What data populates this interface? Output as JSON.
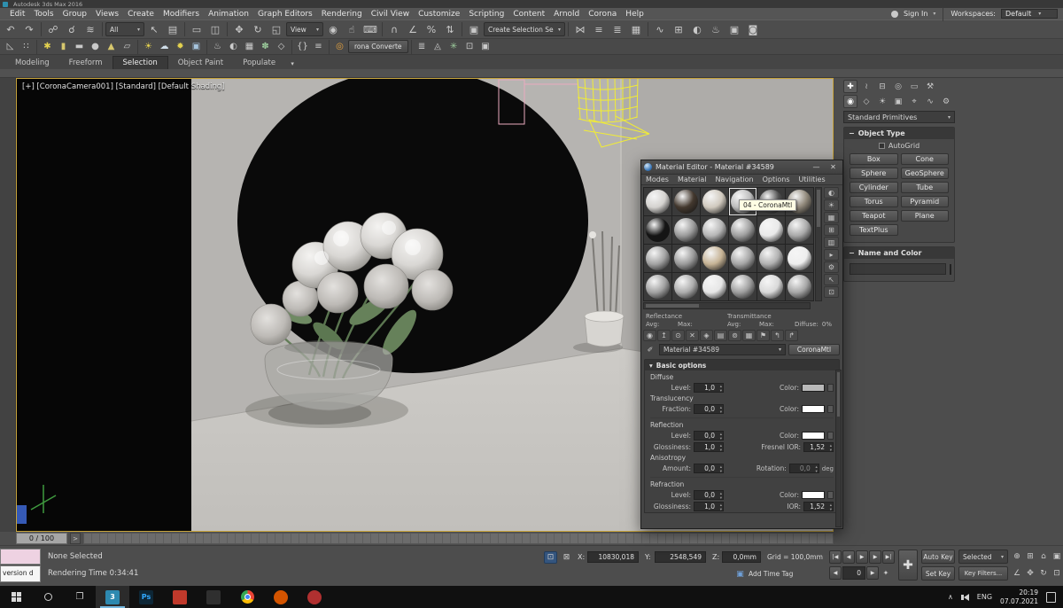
{
  "titlebar": {
    "app_title": "Autodesk 3ds Max 2016"
  },
  "menubar": {
    "items": [
      "Edit",
      "Tools",
      "Group",
      "Views",
      "Create",
      "Modifiers",
      "Animation",
      "Graph Editors",
      "Rendering",
      "Civil View",
      "Customize",
      "Scripting",
      "Content",
      "Arnold",
      "Corona",
      "Help"
    ],
    "sign_in": "Sign In",
    "workspaces_label": "Workspaces:",
    "workspace_value": "Default"
  },
  "toolbar_main": {
    "icons": [
      {
        "type": "icon",
        "name": "undo-icon",
        "glyph": "↶"
      },
      {
        "type": "icon",
        "name": "redo-icon",
        "glyph": "↷"
      },
      {
        "type": "sep"
      },
      {
        "type": "icon",
        "name": "select-and-link-icon",
        "glyph": "☍"
      },
      {
        "type": "icon",
        "name": "unlink-selection-icon",
        "glyph": "☌"
      },
      {
        "type": "icon",
        "name": "bind-to-space-warp-icon",
        "glyph": "≋"
      },
      {
        "type": "sep"
      },
      {
        "type": "dropdown",
        "name": "selection-filter-dropdown",
        "value": "All",
        "w": 44
      },
      {
        "type": "icon",
        "name": "select-object-icon",
        "glyph": "↖"
      },
      {
        "type": "icon",
        "name": "select-by-name-icon",
        "glyph": "▤"
      },
      {
        "type": "sep"
      },
      {
        "type": "icon",
        "name": "rectangular-selection-region-icon",
        "glyph": "▭"
      },
      {
        "type": "icon",
        "name": "window-crossing-toggle-icon",
        "glyph": "◫"
      },
      {
        "type": "sep"
      },
      {
        "type": "icon",
        "name": "select-and-move-icon",
        "glyph": "✥"
      },
      {
        "type": "icon",
        "name": "select-and-rotate-icon",
        "glyph": "↻"
      },
      {
        "type": "icon",
        "name": "select-and-scale-icon",
        "glyph": "◱"
      },
      {
        "type": "dropdown",
        "name": "reference-coordinate-dropdown",
        "value": "View",
        "w": 42
      },
      {
        "type": "icon",
        "name": "use-pivot-point-icon",
        "glyph": "◉"
      },
      {
        "type": "icon",
        "name": "select-and-manipulate-icon",
        "glyph": "☝"
      },
      {
        "type": "icon",
        "name": "keyboard-shortcut-override-icon",
        "glyph": "⌨"
      },
      {
        "type": "sep"
      },
      {
        "type": "icon",
        "name": "snap-toggle-3d-icon",
        "glyph": "∩"
      },
      {
        "type": "icon",
        "name": "angle-snap-icon",
        "glyph": "∠"
      },
      {
        "type": "icon",
        "name": "percent-snap-icon",
        "glyph": "%"
      },
      {
        "type": "icon",
        "name": "spinner-snap-icon",
        "glyph": "⇅"
      },
      {
        "type": "sep"
      },
      {
        "type": "icon",
        "name": "edit-named-selection-sets-icon",
        "glyph": "▣"
      },
      {
        "type": "dropdown",
        "name": "named-selection-sets-dropdown",
        "value": "Create Selection Se",
        "w": 92
      },
      {
        "type": "sep"
      },
      {
        "type": "icon",
        "name": "mirror-icon",
        "glyph": "⋈"
      },
      {
        "type": "icon",
        "name": "align-icon",
        "glyph": "≡"
      },
      {
        "type": "icon",
        "name": "layer-manager-icon",
        "glyph": "≣"
      },
      {
        "type": "icon",
        "name": "graphite-ribbon-toggle-icon",
        "glyph": "▦"
      },
      {
        "type": "sep"
      },
      {
        "type": "icon",
        "name": "curve-editor-icon",
        "glyph": "∿"
      },
      {
        "type": "icon",
        "name": "schematic-view-icon",
        "glyph": "⊞"
      },
      {
        "type": "icon",
        "name": "material-editor-icon",
        "glyph": "◐"
      },
      {
        "type": "icon",
        "name": "render-setup-icon",
        "glyph": "♨"
      },
      {
        "type": "icon",
        "name": "rendered-frame-window-icon",
        "glyph": "▣"
      },
      {
        "type": "icon",
        "name": "render-production-icon",
        "glyph": "◙"
      }
    ]
  },
  "toolbar_extra": {
    "icons": [
      {
        "type": "icon",
        "name": "angle-helper-icon",
        "glyph": "◺",
        "color": "#cccccc"
      },
      {
        "type": "icon",
        "name": "array-tool-icon",
        "glyph": "∷",
        "color": "#cccccc"
      },
      {
        "type": "sep"
      },
      {
        "type": "icon",
        "name": "spline-tool-icon",
        "glyph": "✱",
        "color": "#e4d24f"
      },
      {
        "type": "icon",
        "name": "cylinder-primitive-icon",
        "glyph": "▮",
        "color": "#d7c76d"
      },
      {
        "type": "icon",
        "name": "box-primitive-icon",
        "glyph": "▬",
        "color": "#c9c9c9"
      },
      {
        "type": "icon",
        "name": "sphere-primitive-icon",
        "glyph": "●",
        "color": "#c9c9c9"
      },
      {
        "type": "icon",
        "name": "cone-primitive-icon",
        "glyph": "▲",
        "color": "#d7c76d"
      },
      {
        "type": "icon",
        "name": "plane-primitive-icon",
        "glyph": "▱",
        "color": "#c9c9c9"
      },
      {
        "type": "sep"
      },
      {
        "type": "icon",
        "name": "sun-light-icon",
        "glyph": "☀",
        "color": "#e4d24f"
      },
      {
        "type": "icon",
        "name": "sky-environment-icon",
        "glyph": "☁",
        "color": "#cfdde8"
      },
      {
        "type": "icon",
        "name": "spot-light-icon",
        "glyph": "✹",
        "color": "#e4d24f"
      },
      {
        "type": "icon",
        "name": "camera-icon",
        "glyph": "▣",
        "color": "#a6c4dd"
      },
      {
        "type": "sep"
      },
      {
        "type": "icon",
        "name": "teapot-render-icon",
        "glyph": "♨",
        "color": "#cccccc"
      },
      {
        "type": "icon",
        "name": "material-ball-icon",
        "glyph": "◐",
        "color": "#cccccc"
      },
      {
        "type": "icon",
        "name": "checker-map-icon",
        "glyph": "▦",
        "color": "#cccccc"
      },
      {
        "type": "icon",
        "name": "scatter-tool-icon",
        "glyph": "✽",
        "color": "#9ccc9c"
      },
      {
        "type": "icon",
        "name": "proxy-box-icon",
        "glyph": "◇",
        "color": "#cccccc"
      },
      {
        "type": "sep"
      },
      {
        "type": "icon",
        "name": "script-braces-icon",
        "glyph": "{}",
        "color": "#cccccc"
      },
      {
        "type": "icon",
        "name": "listener-icon",
        "glyph": "≡",
        "color": "#cccccc"
      },
      {
        "type": "sep"
      },
      {
        "type": "icon",
        "name": "corona-logo-icon",
        "glyph": "◎",
        "color": "#e8a33d"
      },
      {
        "type": "button",
        "name": "corona-converter-button",
        "label": "rona Converte"
      },
      {
        "type": "sep"
      },
      {
        "type": "icon",
        "name": "corona-lister-icon",
        "glyph": "≣",
        "color": "#cccccc"
      },
      {
        "type": "icon",
        "name": "corona-proxy-icon",
        "glyph": "◬",
        "color": "#cccccc"
      },
      {
        "type": "icon",
        "name": "corona-scatter-icon",
        "glyph": "✳",
        "color": "#9ccc9c"
      },
      {
        "type": "icon",
        "name": "render-region-icon",
        "glyph": "⊡",
        "color": "#cccccc"
      },
      {
        "type": "icon",
        "name": "frame-buffer-icon",
        "glyph": "▣",
        "color": "#cccccc"
      }
    ]
  },
  "ribbon": {
    "tabs": [
      "Modeling",
      "Freeform",
      "Selection",
      "Object Paint",
      "Populate"
    ],
    "active": "Selection"
  },
  "viewport": {
    "label": "[+] [CoronaCamera001] [Standard] [Default Shading]"
  },
  "command_panel": {
    "tabs": [
      {
        "name": "create-tab",
        "glyph": "✚",
        "active": true
      },
      {
        "name": "modify-tab",
        "glyph": "≀"
      },
      {
        "name": "hierarchy-tab",
        "glyph": "⊟"
      },
      {
        "name": "motion-tab",
        "glyph": "◎"
      },
      {
        "name": "display-tab",
        "glyph": "▭"
      },
      {
        "name": "utilities-tab",
        "glyph": "⚒"
      }
    ],
    "subtabs": [
      {
        "name": "geometry-tab",
        "glyph": "◉",
        "active": true
      },
      {
        "name": "shapes-tab",
        "glyph": "◇"
      },
      {
        "name": "lights-tab",
        "glyph": "☀"
      },
      {
        "name": "cameras-tab",
        "glyph": "▣"
      },
      {
        "name": "helpers-tab",
        "glyph": "⌖"
      },
      {
        "name": "space-warps-tab",
        "glyph": "∿"
      },
      {
        "name": "systems-tab",
        "glyph": "⚙"
      }
    ],
    "category_value": "Standard Primitives",
    "object_type_label": "Object Type",
    "autogrid_label": "AutoGrid",
    "buttons": [
      "Box",
      "Cone",
      "Sphere",
      "GeoSphere",
      "Cylinder",
      "Tube",
      "Torus",
      "Pyramid",
      "Teapot",
      "Plane",
      "TextPlus"
    ],
    "name_color_label": "Name and Color",
    "object_color": "#3fbc3f"
  },
  "timeline": {
    "display": "0 / 100"
  },
  "status": {
    "listener_text": "version d",
    "selection_text": "None Selected",
    "render_time_text": "Rendering Time  0:34:41",
    "x_label": "X:",
    "x_value": "10830,018",
    "y_label": "Y:",
    "y_value": "2548,549",
    "z_label": "Z:",
    "z_value": "0,0mm",
    "grid_text": "Grid = 100,0mm",
    "add_time_tag": "Add Time Tag",
    "auto_key": "Auto Key",
    "set_key": "Set Key",
    "key_mode_value": "Selected",
    "key_filters": "Key Filters...",
    "frame_value": "0",
    "playback": [
      {
        "name": "go-to-start-button",
        "glyph": "|◀"
      },
      {
        "name": "previous-frame-button",
        "glyph": "◀"
      },
      {
        "name": "play-button",
        "glyph": "▶"
      },
      {
        "name": "next-frame-button",
        "glyph": "▶"
      },
      {
        "name": "go-to-end-button",
        "glyph": "▶|"
      }
    ],
    "nav_icons": [
      {
        "name": "zoom-icon",
        "glyph": "⊕"
      },
      {
        "name": "zoom-all-icon",
        "glyph": "⊞"
      },
      {
        "name": "zoom-extents-icon",
        "glyph": "⌂"
      },
      {
        "name": "zoom-extents-all-icon",
        "glyph": "▣"
      },
      {
        "name": "field-of-view-icon",
        "glyph": "∠"
      },
      {
        "name": "pan-icon",
        "glyph": "✥"
      },
      {
        "name": "orbit-icon",
        "glyph": "↻"
      },
      {
        "name": "maximize-viewport-icon",
        "glyph": "⊡"
      }
    ]
  },
  "taskbar": {
    "language": "ENG",
    "time": "20:19",
    "date": "07.07.2021",
    "apps": [
      {
        "name": "taskbar-app-3dsmax",
        "label": "3",
        "bg": "#2d89b0",
        "fg": "#ffffff",
        "active": true
      },
      {
        "name": "taskbar-app-photoshop",
        "label": "Ps",
        "bg": "#0d2636",
        "fg": "#31a8ff"
      },
      {
        "name": "taskbar-app-red",
        "label": "",
        "bg": "#c0392b",
        "fg": "#ffffff"
      },
      {
        "name": "taskbar-app-dark",
        "label": "",
        "bg": "#2f2f2f",
        "fg": "#cccccc"
      },
      {
        "name": "taskbar-app-chrome",
        "label": "",
        "bg": "chrome",
        "fg": ""
      },
      {
        "name": "taskbar-app-orange",
        "label": "",
        "bg": "#d35400",
        "fg": "#ffffff",
        "round": true
      },
      {
        "name": "taskbar-app-media",
        "label": "",
        "bg": "#b03030",
        "fg": "#ffffff",
        "round": true
      }
    ]
  },
  "material_editor": {
    "title": "Material Editor - Material #34589",
    "window_controls": {
      "minimize": "—",
      "close": "✕"
    },
    "menus": [
      "Modes",
      "Material",
      "Navigation",
      "Options",
      "Utilities"
    ],
    "tooltip": "04 - CoronaMtl",
    "selected_index": 3,
    "swatches": [
      "#d4d2cf",
      "#43382e",
      "#d0c9be",
      "#bdbdbd",
      "#4f4f4f",
      "#8f8779",
      "#141414",
      "#9b9b9b",
      "#b6b6b6",
      "#9f9f9f",
      "#e9e9e9",
      "#a9a9a9",
      "#a3a3a3",
      "#9b9b9b",
      "#c6b395",
      "#a6a6a6",
      "#b1b1b1",
      "#eeeeee",
      "#a1a1a1",
      "#acacac",
      "#e6e6e6",
      "#9e9e9e",
      "#d9d9d9",
      "#a6a6a6"
    ],
    "side_tools": [
      {
        "name": "sample-type-icon",
        "glyph": "◐"
      },
      {
        "name": "backlight-icon",
        "glyph": "☀"
      },
      {
        "name": "background-icon",
        "glyph": "▦"
      },
      {
        "name": "sample-tiling-icon",
        "glyph": "⊞"
      },
      {
        "name": "video-color-check-icon",
        "glyph": "▥"
      },
      {
        "name": "make-preview-icon",
        "glyph": "▸"
      },
      {
        "name": "options-icon",
        "glyph": "⚙"
      },
      {
        "name": "select-by-material-icon",
        "glyph": "↖"
      },
      {
        "name": "material-map-navigator-icon",
        "glyph": "⊡"
      }
    ],
    "tools": [
      {
        "name": "get-material-icon",
        "glyph": "◉"
      },
      {
        "name": "put-to-scene-icon",
        "glyph": "↥"
      },
      {
        "name": "assign-to-selection-icon",
        "glyph": "⊙"
      },
      {
        "name": "reset-map-icon",
        "glyph": "✕"
      },
      {
        "name": "make-unique-icon",
        "glyph": "◈"
      },
      {
        "name": "put-to-library-icon",
        "glyph": "▤"
      },
      {
        "name": "material-id-icon",
        "glyph": "⊚"
      },
      {
        "name": "show-map-in-viewport-icon",
        "glyph": "▦"
      },
      {
        "name": "show-end-result-icon",
        "glyph": "⚑"
      },
      {
        "name": "go-to-parent-icon",
        "glyph": "↰"
      },
      {
        "name": "go-forward-icon",
        "glyph": "↱"
      }
    ],
    "stats": {
      "reflectance_label": "Reflectance",
      "transmittance_label": "Transmittance",
      "avg_label": "Avg:",
      "max_label": "Max:",
      "diffuse_label": "Diffuse:",
      "diffuse_value": "0%"
    },
    "name_value": "Material #34589",
    "type_button": "CoronaMtl",
    "rollout_title": "Basic options",
    "params": {
      "diffuse_label": "Diffuse",
      "level_label": "Level:",
      "color_label": "Color:",
      "diffuse_level": "1,0",
      "diffuse_color": "#b9b9b9",
      "translucency_label": "Translucency",
      "fraction_label": "Fraction:",
      "translucency_fraction": "0,0",
      "translucency_color": "#ffffff",
      "reflection_label": "Reflection",
      "reflection_level": "0,0",
      "reflection_color": "#ffffff",
      "glossiness_label": "Glossiness:",
      "reflection_glossiness": "1,0",
      "fresnel_label": "Fresnel IOR:",
      "fresnel_ior": "1,52",
      "anisotropy_label": "Anisotropy",
      "amount_label": "Amount:",
      "anisotropy_amount": "0,0",
      "rotation_label": "Rotation:",
      "anisotropy_rotation": "0,0",
      "deg_label": "deg",
      "refraction_label": "Refraction",
      "refraction_level": "0,0",
      "refraction_color": "#ffffff",
      "refraction_glossiness": "1,0",
      "ior_label": "IOR:",
      "refraction_ior": "1,52"
    }
  },
  "colors": {
    "ui_background": "#4d4d4d",
    "viewport_background": "#b4b2af",
    "active_viewport_border": "#c7a43c",
    "mirror_black": "#0a0a0a",
    "selection_wireframe_yellow": "#f1ec35",
    "object_color_green": "#3fbc3f"
  }
}
